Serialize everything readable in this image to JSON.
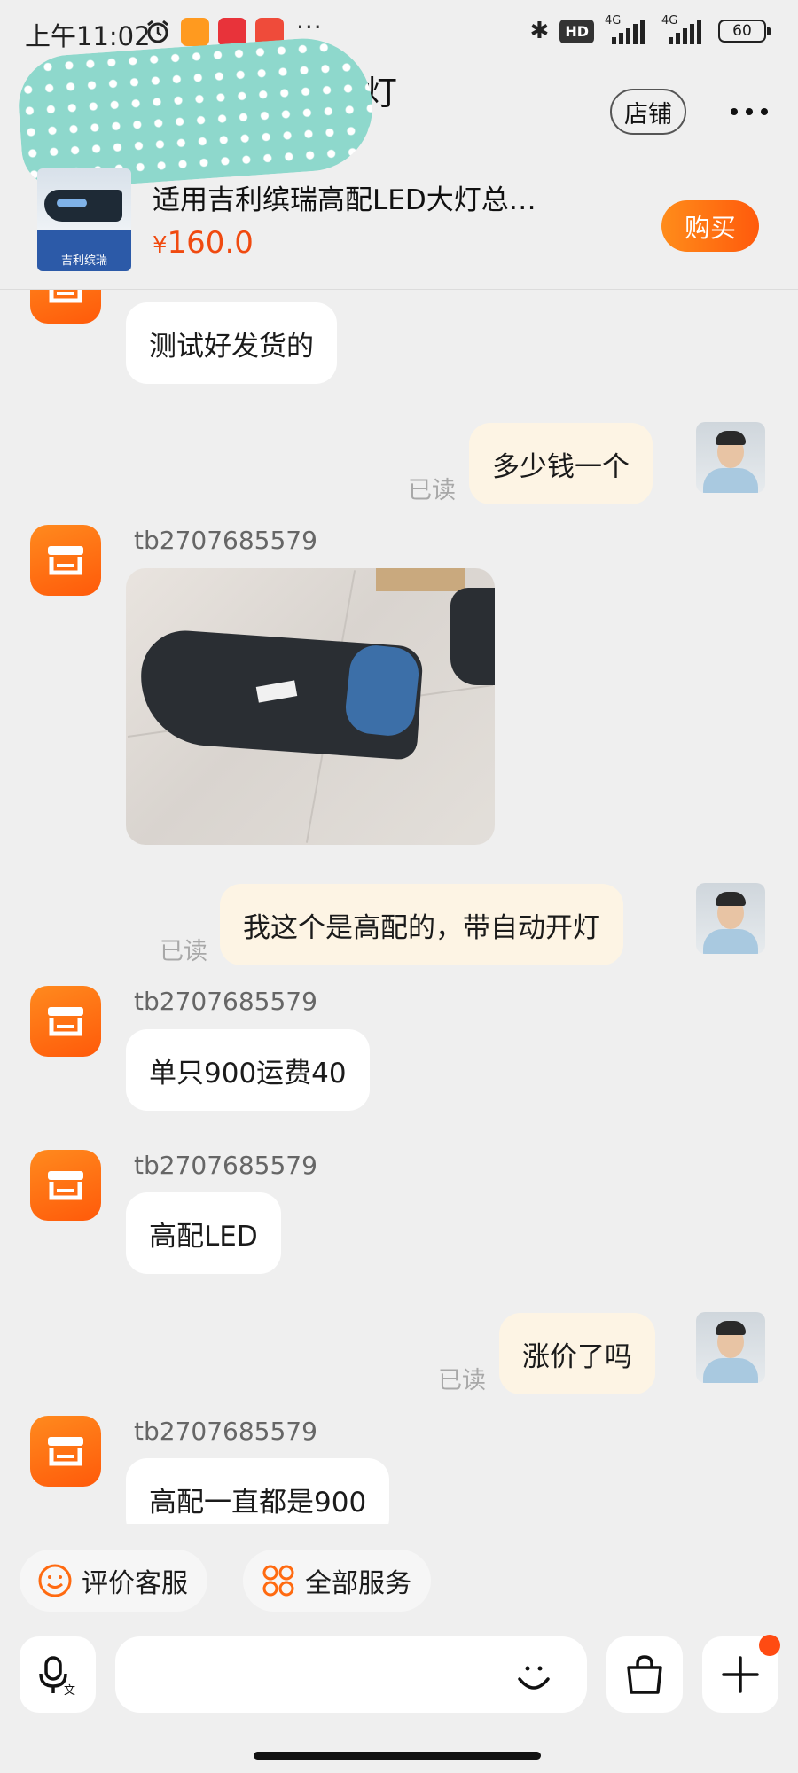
{
  "status_bar": {
    "time": "上午11:02",
    "more": "···",
    "hd_badge": "HD",
    "network_1": "4G",
    "network_2": "4G",
    "battery": "60"
  },
  "header": {
    "title_fragment": "灯",
    "shop_label": "店铺"
  },
  "product": {
    "title": "适用吉利缤瑞高配LED大灯总…",
    "currency": "¥",
    "price": "160.0",
    "buy_label": "购买",
    "thumb_tag": "吉利缤瑞"
  },
  "messages": [
    {
      "id": "m1",
      "side": "seller",
      "text": "测试好发货的"
    },
    {
      "id": "m2",
      "side": "buyer",
      "text": "多少钱一个",
      "read": "已读"
    },
    {
      "id": "m3",
      "side": "seller",
      "sender": "tb2707685579",
      "type": "image"
    },
    {
      "id": "m4",
      "side": "buyer",
      "text": "我这个是高配的，带自动开灯",
      "read": "已读"
    },
    {
      "id": "m5",
      "side": "seller",
      "sender": "tb2707685579",
      "text": "单只900运费40"
    },
    {
      "id": "m6",
      "side": "seller",
      "sender": "tb2707685579",
      "text": "高配LED"
    },
    {
      "id": "m7",
      "side": "buyer",
      "text": "涨价了吗",
      "read": "已读"
    },
    {
      "id": "m8",
      "side": "seller",
      "sender": "tb2707685579",
      "text": "高配一直都是900"
    }
  ],
  "service_chips": [
    {
      "label": "评价客服",
      "icon": "smile-icon"
    },
    {
      "label": "全部服务",
      "icon": "grid-icon"
    }
  ],
  "input_bar": {
    "placeholder": "",
    "voice_icon": "voice-translate-icon",
    "emoji_icon": "smile-icon",
    "bag_icon": "shopping-bag-icon",
    "plus_icon": "plus-icon"
  },
  "colors": {
    "accent": "#ff6a10",
    "price": "#f04a10",
    "outgoing_bubble": "#fdf4e4",
    "incoming_bubble": "#ffffff",
    "background": "#efefef"
  }
}
